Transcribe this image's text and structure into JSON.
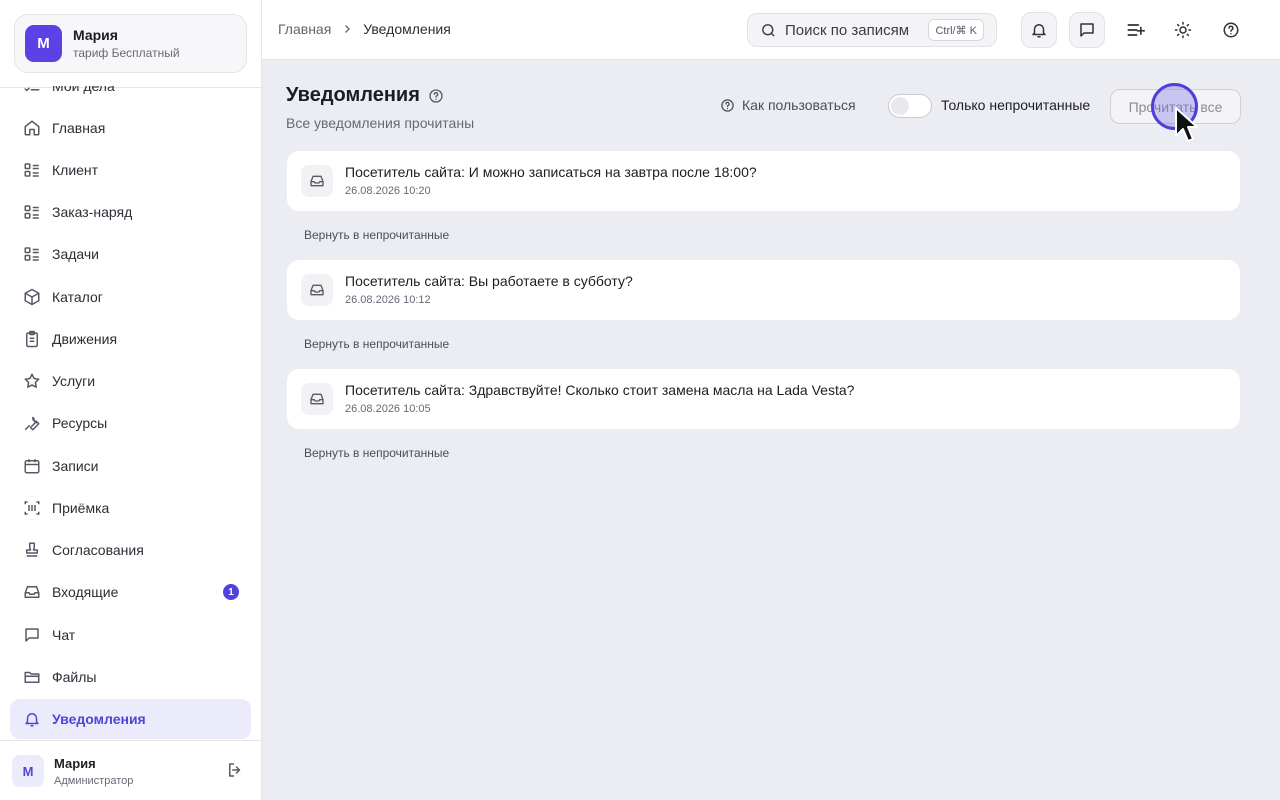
{
  "profile": {
    "initial": "М",
    "name": "Мария",
    "plan": "тариф Бесплатный"
  },
  "sidebar": {
    "partial_item": "Мои дела",
    "items": [
      {
        "label": "Главная",
        "icon": "home-icon"
      },
      {
        "label": "Клиент",
        "icon": "list-icon"
      },
      {
        "label": "Заказ-наряд",
        "icon": "list-icon"
      },
      {
        "label": "Задачи",
        "icon": "list-icon"
      },
      {
        "label": "Каталог",
        "icon": "box-icon"
      },
      {
        "label": "Движения",
        "icon": "clipboard-icon"
      },
      {
        "label": "Услуги",
        "icon": "star-icon"
      },
      {
        "label": "Ресурсы",
        "icon": "wrench-icon"
      },
      {
        "label": "Записи",
        "icon": "calendar-icon"
      },
      {
        "label": "Приёмка",
        "icon": "barcode-icon"
      },
      {
        "label": "Согласования",
        "icon": "stamp-icon"
      },
      {
        "label": "Входящие",
        "icon": "inbox-icon",
        "badge": "1"
      },
      {
        "label": "Чат",
        "icon": "chat-icon"
      },
      {
        "label": "Файлы",
        "icon": "folder-icon"
      },
      {
        "label": "Уведомления",
        "icon": "bell-icon",
        "active": true
      }
    ]
  },
  "user": {
    "initial": "М",
    "name": "Мария",
    "role": "Администратор"
  },
  "breadcrumb": {
    "home": "Главная",
    "current": "Уведомления"
  },
  "search": {
    "placeholder": "Поиск по записям",
    "shortcut": "Ctrl/⌘ K"
  },
  "header": {
    "title": "Уведомления",
    "subtitle": "Все уведомления прочитаны",
    "howto": "Как пользоваться",
    "toggle_label": "Только непрочитанные",
    "toggle_on": false,
    "read_all": "Прочитать все"
  },
  "notifications": [
    {
      "text": "Посетитель сайта: И можно записаться на завтра после 18:00?",
      "time": "26.08.2026 10:20",
      "action": "Вернуть в непрочитанные"
    },
    {
      "text": "Посетитель сайта: Вы работаете в субботу?",
      "time": "26.08.2026 10:12",
      "action": "Вернуть в непрочитанные"
    },
    {
      "text": "Посетитель сайта: Здравствуйте! Сколько стоит замена масла на Lada Vesta?",
      "time": "26.08.2026 10:05",
      "action": "Вернуть в непрочитанные"
    }
  ],
  "colors": {
    "accent": "#5142e0",
    "active_bg": "#ebebfc",
    "page_bg": "#ecedf2"
  }
}
